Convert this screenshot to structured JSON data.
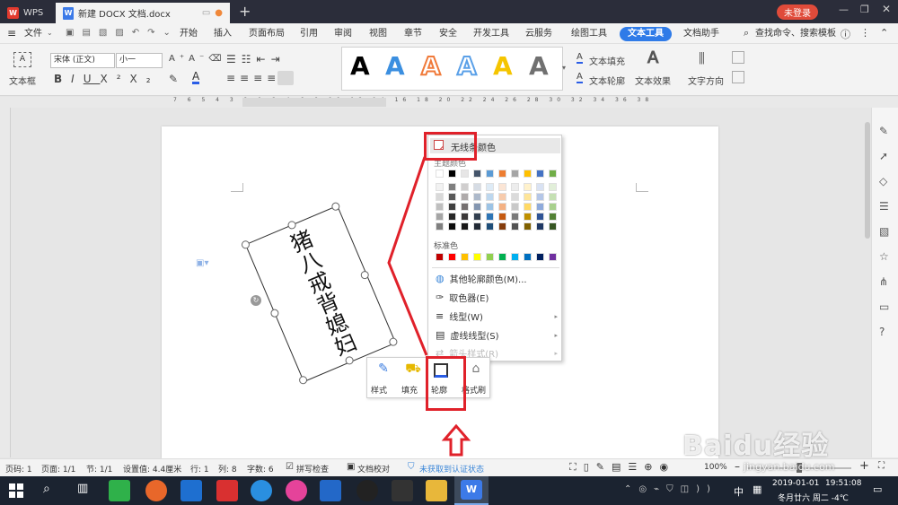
{
  "app": {
    "name": "WPS",
    "tab_title": "新建 DOCX 文档.docx",
    "login": "未登录"
  },
  "menu": {
    "file": "文件",
    "items": [
      "开始",
      "插入",
      "页面布局",
      "引用",
      "审阅",
      "视图",
      "章节",
      "安全",
      "开发工具",
      "云服务",
      "绘图工具",
      "文本工具",
      "文档助手"
    ],
    "search": "查找命令、搜索模板"
  },
  "ribbon": {
    "textbox": "文本框",
    "font_name": "宋体 (正文)",
    "font_size": "小一",
    "text_fill": "文本填充",
    "text_outline": "文本轮廓",
    "text_effect": "文本效果",
    "text_direction": "文字方向",
    "style_letter": "A",
    "style_colors": [
      "#000000",
      "#3b8fe0",
      "#f07a3a",
      "#5aa0e8",
      "#f5c500",
      "#707070"
    ]
  },
  "ruler": {
    "top": "7 6 5 4 3 2 1 2 4 6 8 10 12 14 16 18 20 22 24 26 28 30 32 34 36 38"
  },
  "document": {
    "textbox_text": "猪八戒背媳妇"
  },
  "popup": {
    "no_color": "无线条颜色",
    "theme_title": "主题颜色",
    "standard_title": "标准色",
    "more_colors": "其他轮廓颜色(M)...",
    "eyedropper": "取色器(E)",
    "line_type": "线型(W)",
    "dash_type": "虚线线型(S)",
    "arrow_style": "箭头样式(R)",
    "theme_top": [
      "#ffffff",
      "#000000",
      "#e7e6e6",
      "#44546a",
      "#5b9bd5",
      "#ed7d31",
      "#a5a5a5",
      "#ffc000",
      "#4472c4",
      "#70ad47"
    ],
    "theme_shades": [
      [
        "#f2f2f2",
        "#7f7f7f",
        "#d0cece",
        "#d6dce4",
        "#deebf6",
        "#fbe5d5",
        "#ededed",
        "#fff2cc",
        "#d9e2f3",
        "#e2efd9"
      ],
      [
        "#d9d9d9",
        "#595959",
        "#aeaaaa",
        "#adb9ca",
        "#bdd7ee",
        "#f7cbac",
        "#dbdbdb",
        "#fee599",
        "#b4c6e7",
        "#c5e0b3"
      ],
      [
        "#bfbfbf",
        "#3f3f3f",
        "#757070",
        "#8496b0",
        "#9cc3e5",
        "#f4b183",
        "#c9c9c9",
        "#ffd965",
        "#8eaadb",
        "#a8d08d"
      ],
      [
        "#a5a5a5",
        "#262626",
        "#3a3838",
        "#323f4f",
        "#2e75b5",
        "#c55a11",
        "#7b7b7b",
        "#bf9000",
        "#2f5496",
        "#538135"
      ],
      [
        "#7f7f7f",
        "#0c0c0c",
        "#171616",
        "#222a35",
        "#1e4e79",
        "#843c0b",
        "#525252",
        "#7f6000",
        "#1f3864",
        "#375623"
      ]
    ],
    "standard": [
      "#c00000",
      "#ff0000",
      "#ffc000",
      "#ffff00",
      "#92d050",
      "#00b050",
      "#00b0f0",
      "#0070c0",
      "#002060",
      "#7030a0"
    ]
  },
  "minitoolbar": {
    "style": "样式",
    "fill": "填充",
    "outline": "轮廓",
    "format_painter": "格式刷"
  },
  "status": {
    "page_num": "页码: 1",
    "pages": "页面: 1/1",
    "section": "节: 1/1",
    "setting": "设置值: 4.4厘米",
    "row": "行: 1",
    "col": "列: 8",
    "words": "字数: 6",
    "spell": "拼写检查",
    "proof": "文档校对",
    "cert": "未获取到认证状态",
    "zoom": "100%"
  },
  "taskbar": {
    "time": "19:51:08",
    "date": "2019-01-01",
    "weekday": "冬月廿六 周二 -4℃",
    "ime": "中",
    "watermark": "Baidu经验",
    "watermark_url": "jingyan.baidu.com"
  }
}
